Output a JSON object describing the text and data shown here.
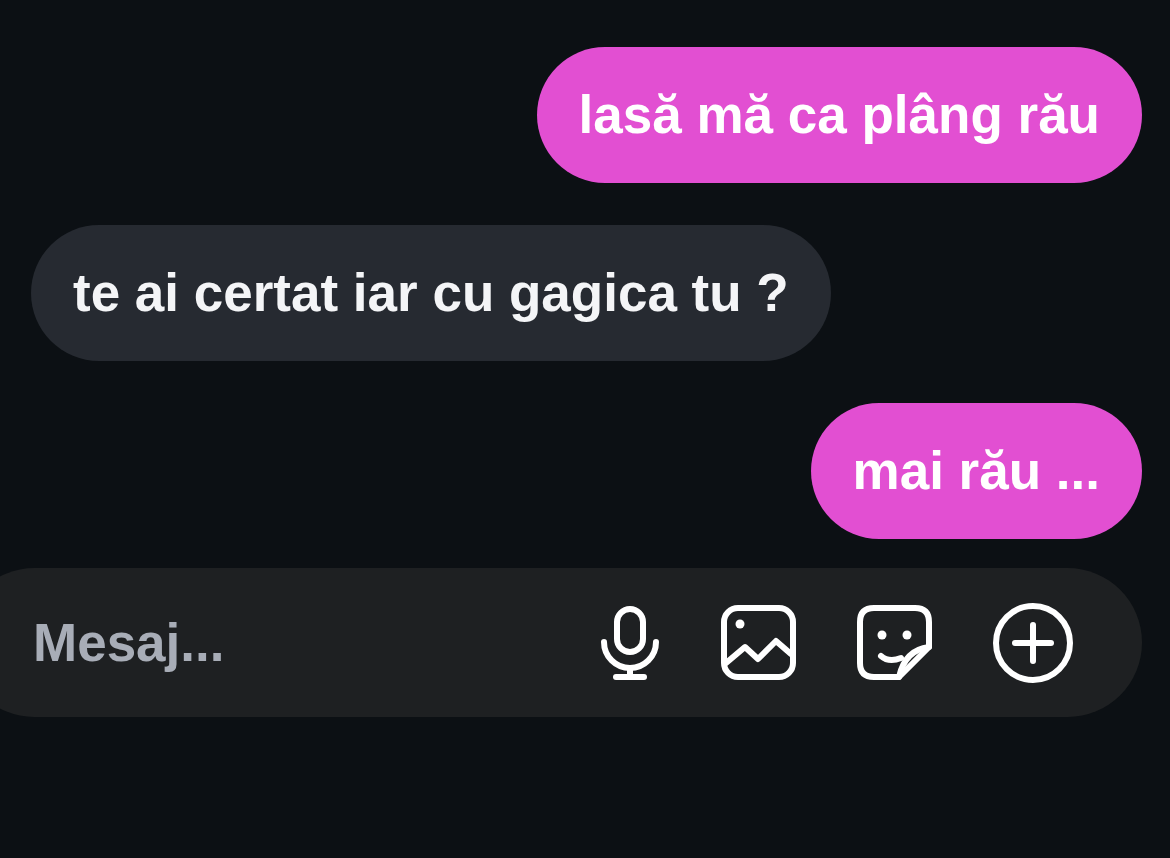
{
  "messages": [
    {
      "kind": "sent",
      "text": "lasă mă ca plâng rău"
    },
    {
      "kind": "received",
      "text": "te ai certat iar cu gagica tu ?"
    },
    {
      "kind": "sent",
      "text": "mai rău ..."
    }
  ],
  "composer": {
    "placeholder": "Mesaj..."
  }
}
